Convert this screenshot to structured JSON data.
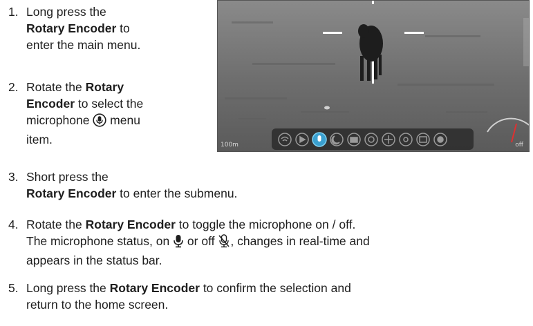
{
  "steps": [
    {
      "number": "1.",
      "parts": [
        "Long press the ",
        "Rotary Encoder",
        " to enter the main menu."
      ]
    },
    {
      "number": "2.",
      "parts": [
        "Rotate the ",
        "Rotary Encoder",
        " to select the microphone ",
        " menu item."
      ],
      "icon": "microphone-circle-icon"
    },
    {
      "number": "3.",
      "parts": [
        "Short press the ",
        "Rotary Encoder",
        " to enter the submenu."
      ]
    },
    {
      "number": "4.",
      "parts": [
        "Rotate the ",
        "Rotary Encoder",
        " to toggle the microphone on / off. The microphone status, on ",
        " or off ",
        ", changes in real-time and appears in the status bar."
      ],
      "icons": [
        "microphone-on-icon",
        "microphone-off-icon"
      ]
    },
    {
      "number": "5.",
      "parts": [
        "Long press the ",
        "Rotary Encoder",
        " to confirm the selection and return to the home screen."
      ]
    }
  ],
  "screen": {
    "range_label": "100m",
    "mic_status_label": "off",
    "menu_icons": [
      "wifi-icon",
      "play-icon",
      "microphone-icon",
      "night-mode-icon",
      "camera-icon",
      "palette-icon",
      "zoom-icon",
      "crosshair-icon",
      "image-icon",
      "settings-icon"
    ],
    "selected_menu_item": "microphone-icon"
  },
  "colors": {
    "text": "#1e1e1e",
    "selected_menu": "#3aa0d0",
    "compass_needle": "#e03030"
  }
}
